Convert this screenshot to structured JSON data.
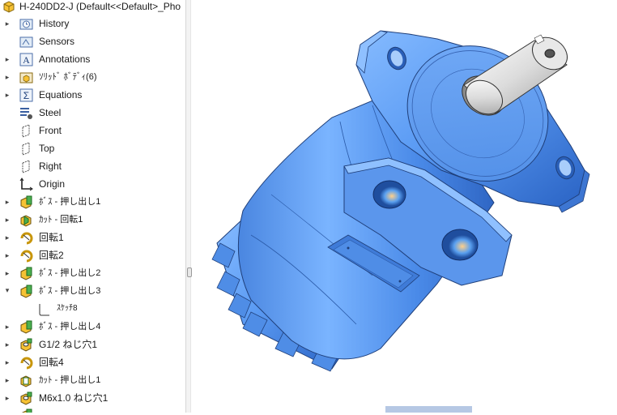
{
  "root": {
    "label": "H-240DD2-J  (Default<<Default>_Pho"
  },
  "tree": [
    {
      "label": "History",
      "icon": "history-folder-icon"
    },
    {
      "label": "Sensors",
      "icon": "sensors-folder-icon"
    },
    {
      "label": "Annotations",
      "icon": "annotations-icon"
    },
    {
      "label": "ｿﾘｯﾄﾞ ﾎﾞﾃﾞｨ(6)",
      "icon": "solid-bodies-folder-icon"
    },
    {
      "label": "Equations",
      "icon": "equations-icon"
    },
    {
      "label": "Steel",
      "icon": "material-icon"
    },
    {
      "label": "Front",
      "icon": "plane-icon"
    },
    {
      "label": "Top",
      "icon": "plane-icon"
    },
    {
      "label": "Right",
      "icon": "plane-icon"
    },
    {
      "label": "Origin",
      "icon": "origin-icon"
    },
    {
      "label": "ﾎﾞｽ - 押し出し1",
      "icon": "boss-extrude-icon"
    },
    {
      "label": "ｶｯﾄ - 回転1",
      "icon": "cut-revolve-icon"
    },
    {
      "label": "回転1",
      "icon": "revolve-icon"
    },
    {
      "label": "回転2",
      "icon": "revolve-icon"
    },
    {
      "label": "ﾎﾞｽ - 押し出し2",
      "icon": "boss-extrude-icon"
    },
    {
      "label": "ﾎﾞｽ - 押し出し3",
      "icon": "boss-extrude-icon"
    },
    {
      "label": "ｽｹｯﾁ8",
      "icon": "sketch-icon"
    },
    {
      "label": "ﾎﾞｽ - 押し出し4",
      "icon": "boss-extrude-icon"
    },
    {
      "label": "G1/2 ねじ穴1",
      "icon": "hole-wizard-icon"
    },
    {
      "label": "回転4",
      "icon": "revolve-icon"
    },
    {
      "label": "ｶｯﾄ - 押し出し1",
      "icon": "cut-extrude-icon"
    },
    {
      "label": "M6x1.0 ねじ穴1",
      "icon": "hole-wizard-icon"
    }
  ],
  "colors": {
    "part_blue": "#5f9ff5",
    "part_blue_light": "#8cc0ff",
    "part_blue_dark": "#2d66c8",
    "shaft_gray": "#e4e4e4",
    "selection_bar": "#b6c8e4"
  }
}
